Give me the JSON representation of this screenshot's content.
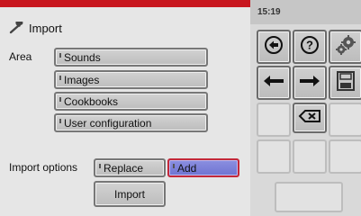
{
  "status_bar": {
    "time": "15:19",
    "accent_color": "#c8161e"
  },
  "header": {
    "title": "Import",
    "icon": "wrench-icon"
  },
  "area": {
    "label": "Area",
    "options": [
      "Sounds",
      "Images",
      "Cookbooks",
      "User configuration"
    ]
  },
  "import_options": {
    "label": "Import options",
    "choices": [
      "Replace",
      "Add"
    ],
    "selected": "Add",
    "selected_color": "#7b80d9"
  },
  "actions": {
    "import_label": "Import"
  },
  "toolbar": {
    "icons": [
      "back-circle-icon",
      "help-icon",
      "settings-gears-icon",
      "arrow-left-icon",
      "arrow-right-icon",
      "save-disk-icon",
      "backspace-icon"
    ]
  }
}
